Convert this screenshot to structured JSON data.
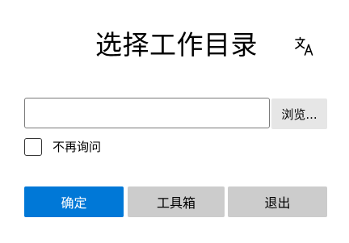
{
  "dialog": {
    "title": "选择工作目录",
    "language_icon": "translate-icon"
  },
  "path_input": {
    "value": "",
    "placeholder": ""
  },
  "browse_button": {
    "label": "浏览..."
  },
  "dont_ask_checkbox": {
    "label": "不再询问",
    "checked": false
  },
  "buttons": {
    "ok_label": "确定",
    "tools_label": "工具箱",
    "exit_label": "退出"
  },
  "colors": {
    "primary": "#0078d7",
    "secondary": "#cccccc",
    "browse": "#e6e6e6"
  }
}
